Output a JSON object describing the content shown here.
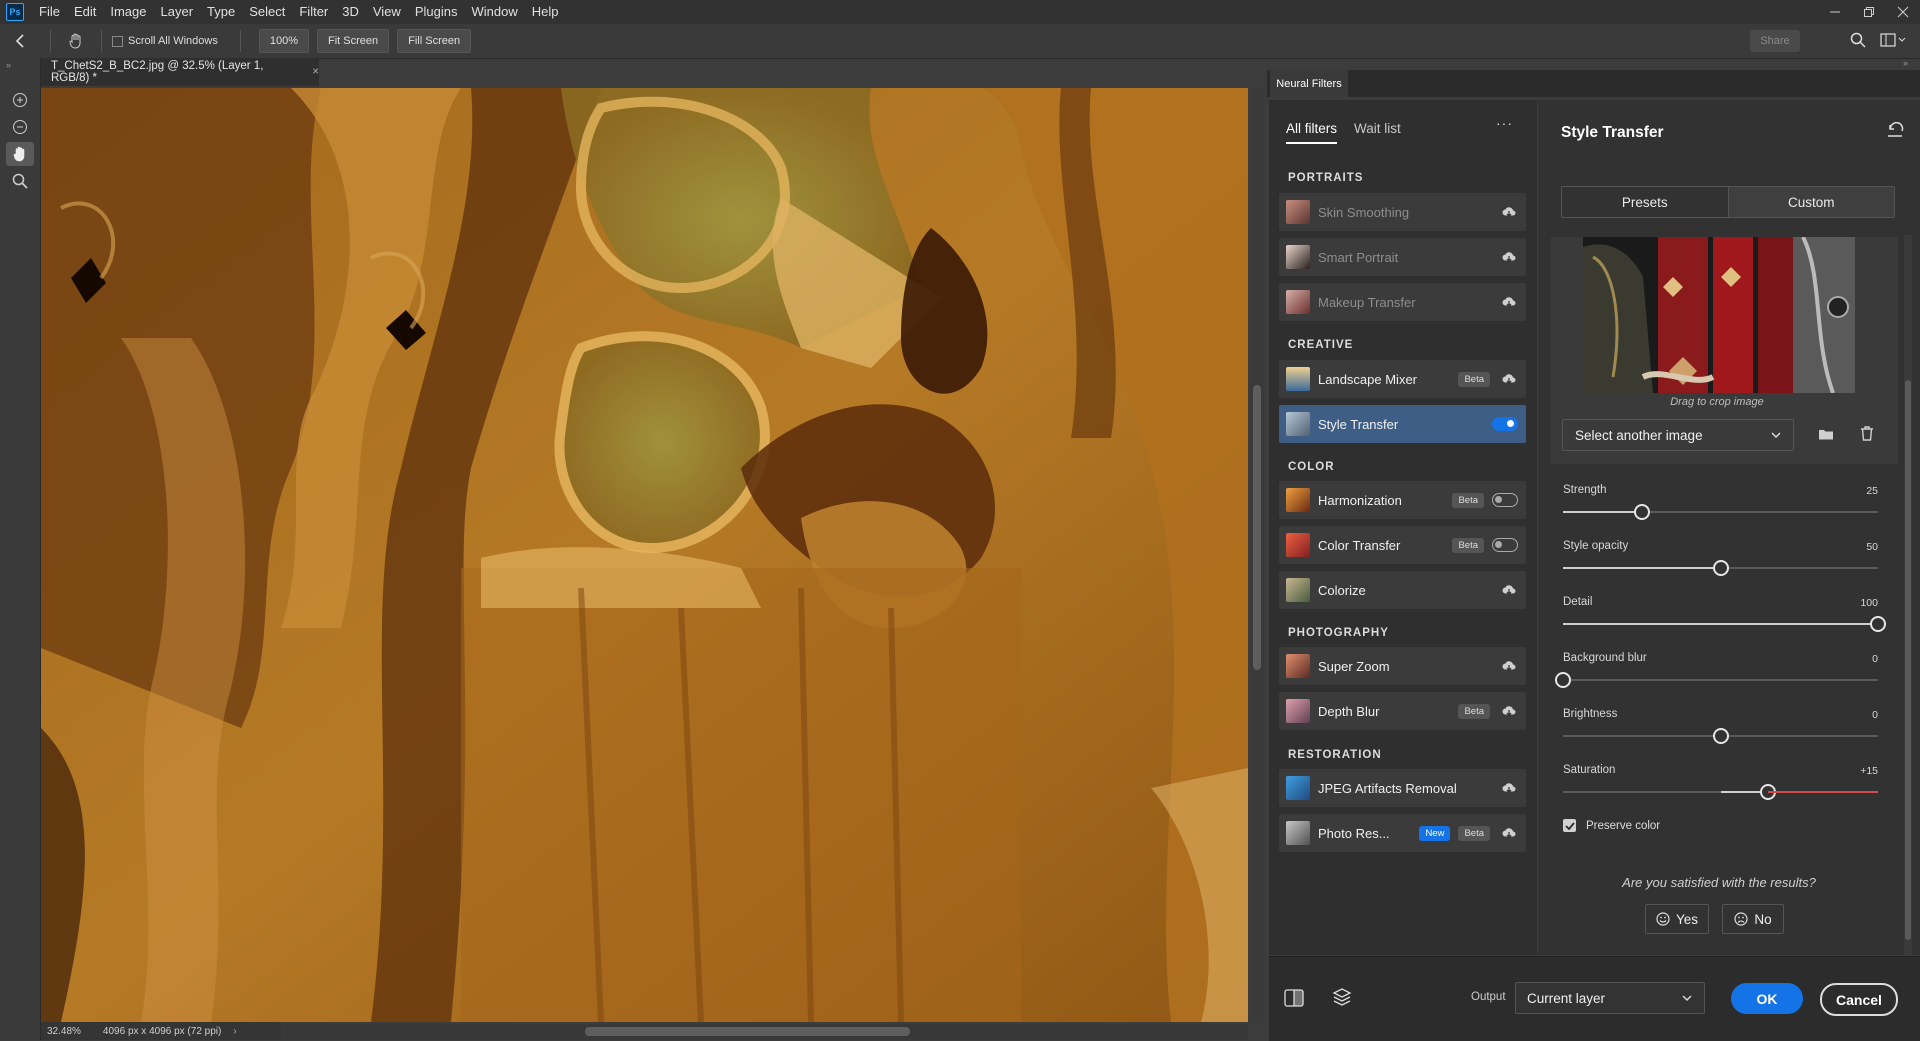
{
  "app": {
    "logo": "Ps",
    "menu": [
      "File",
      "Edit",
      "Image",
      "Layer",
      "Type",
      "Select",
      "Filter",
      "3D",
      "View",
      "Plugins",
      "Window",
      "Help"
    ],
    "window_controls": [
      "minimize-icon",
      "restore-icon",
      "close-icon"
    ]
  },
  "options_bar": {
    "scroll_all_windows": "Scroll All Windows",
    "zoom_100": "100%",
    "fit_screen": "Fit Screen",
    "fill_screen": "Fill Screen",
    "share": "Share"
  },
  "document": {
    "tab_title": "T_ChetS2_B_BC2.jpg @ 32.5% (Layer 1, RGB/8) *",
    "zoom": "32.48%",
    "dimensions": "4096 px x 4096 px (72 ppi)"
  },
  "neural_filters": {
    "panel_title": "Neural Filters",
    "tabs": {
      "all": "All filters",
      "wait": "Wait list"
    },
    "categories": {
      "portraits": "PORTRAITS",
      "creative": "CREATIVE",
      "color": "COLOR",
      "photography": "PHOTOGRAPHY",
      "restoration": "RESTORATION"
    },
    "filters": {
      "skin": "Skin Smoothing",
      "smart": "Smart Portrait",
      "makeup": "Makeup Transfer",
      "landscape": "Landscape Mixer",
      "style": "Style Transfer",
      "harmonization": "Harmonization",
      "color_transfer": "Color Transfer",
      "colorize": "Colorize",
      "super_zoom": "Super Zoom",
      "depth_blur": "Depth Blur",
      "jpeg": "JPEG Artifacts Removal",
      "photo_res": "Photo Res..."
    },
    "badges": {
      "beta": "Beta",
      "new": "New"
    },
    "colors": {
      "accent": "#1473e6",
      "selected_row": "#3e5e86"
    }
  },
  "style_transfer": {
    "title": "Style Transfer",
    "segments": {
      "presets": "Presets",
      "custom": "Custom"
    },
    "drag_hint": "Drag to crop image",
    "select_image": "Select another image",
    "sliders": {
      "strength": {
        "label": "Strength",
        "value": "25",
        "fraction": 0.25
      },
      "opacity": {
        "label": "Style opacity",
        "value": "50",
        "fraction": 0.5
      },
      "detail": {
        "label": "Detail",
        "value": "100",
        "fraction": 1.0
      },
      "bgblur": {
        "label": "Background blur",
        "value": "0",
        "fraction": 0.0
      },
      "brightness": {
        "label": "Brightness",
        "value": "0",
        "fraction": 0.5
      },
      "saturation": {
        "label": "Saturation",
        "value": "+15",
        "fraction": 0.65
      }
    },
    "preserve_color": "Preserve color",
    "feedback_question": "Are you satisfied with the results?",
    "yes": "Yes",
    "no": "No"
  },
  "footer": {
    "output_label": "Output",
    "output_value": "Current layer",
    "ok": "OK",
    "cancel": "Cancel"
  }
}
